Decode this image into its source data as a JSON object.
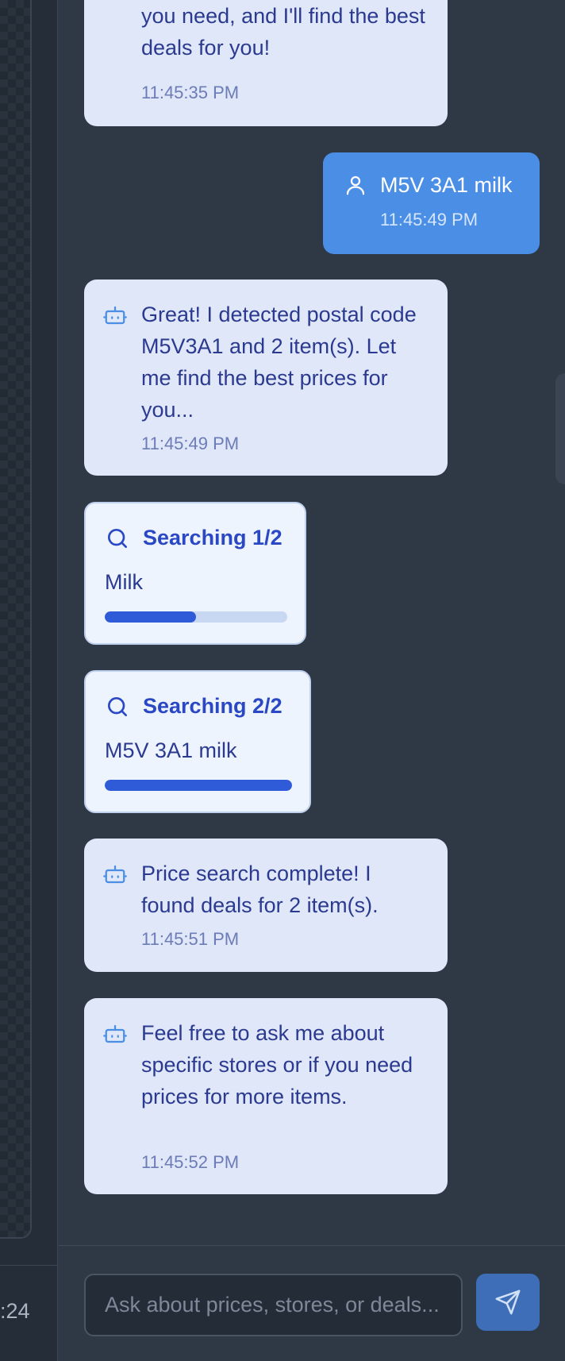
{
  "left_panel": {
    "footer_text": ":24"
  },
  "messages": [
    {
      "role": "bot",
      "text": "postal code and what items you need, and I'll find the best deals for you!",
      "time": "11:45:35 PM"
    },
    {
      "role": "user",
      "text": "M5V 3A1 milk",
      "time": "11:45:49 PM"
    },
    {
      "role": "bot",
      "text": "Great! I detected postal code M5V3A1 and 2 item(s). Let me find the best prices for you...",
      "time": "11:45:49 PM"
    },
    {
      "role": "search",
      "title": "Searching 1/2",
      "item": "Milk",
      "progress": 0.5
    },
    {
      "role": "search",
      "title": "Searching 2/2",
      "item": "M5V 3A1 milk",
      "progress": 1.0
    },
    {
      "role": "bot",
      "text": "Price search complete! I found deals for 2 item(s).",
      "time": "11:45:51 PM"
    },
    {
      "role": "bot",
      "text": "Feel free to ask me about specific stores or if you need prices for more items.",
      "time": "11:45:52 PM"
    }
  ],
  "input": {
    "placeholder": "Ask about prices, stores, or deals...",
    "value": ""
  },
  "icons": {
    "bot": "robot-icon",
    "user": "user-icon",
    "search": "search-icon",
    "send": "send-icon"
  },
  "colors": {
    "background": "#2f3845",
    "bot_bubble": "#dfe7f8",
    "user_bubble": "#4a8ee6",
    "progress": "#2f5bd8",
    "send_button": "#3f6eb8"
  }
}
